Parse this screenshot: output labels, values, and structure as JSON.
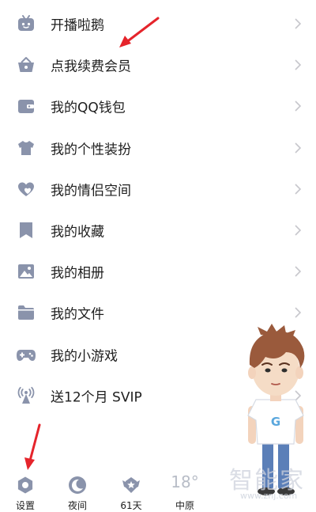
{
  "menu": {
    "items": [
      {
        "label": "开播啦鹅",
        "icon": "tv-icon"
      },
      {
        "label": "点我续费会员",
        "icon": "crown-basket-icon"
      },
      {
        "label": "我的QQ钱包",
        "icon": "wallet-icon"
      },
      {
        "label": "我的个性装扮",
        "icon": "tshirt-icon"
      },
      {
        "label": "我的情侣空间",
        "icon": "couple-heart-icon"
      },
      {
        "label": "我的收藏",
        "icon": "bookmark-icon"
      },
      {
        "label": "我的相册",
        "icon": "photo-icon"
      },
      {
        "label": "我的文件",
        "icon": "folder-icon"
      },
      {
        "label": "我的小游戏",
        "icon": "gamepad-icon"
      },
      {
        "label": "送12个月 SVIP",
        "icon": "broadcast-icon"
      }
    ]
  },
  "bottom_bar": {
    "settings_label": "设置",
    "night_label": "夜间",
    "days_label": "61天",
    "temperature": "18°",
    "city": "中原"
  },
  "character": {
    "shirt_letter": "G"
  },
  "watermark": {
    "title": "智能家",
    "url": "www.znj.com"
  },
  "colors": {
    "icon": "#8a93ab",
    "text": "#1e1e1e",
    "chevron": "#c7c7cc",
    "arrow": "#e5242b"
  }
}
